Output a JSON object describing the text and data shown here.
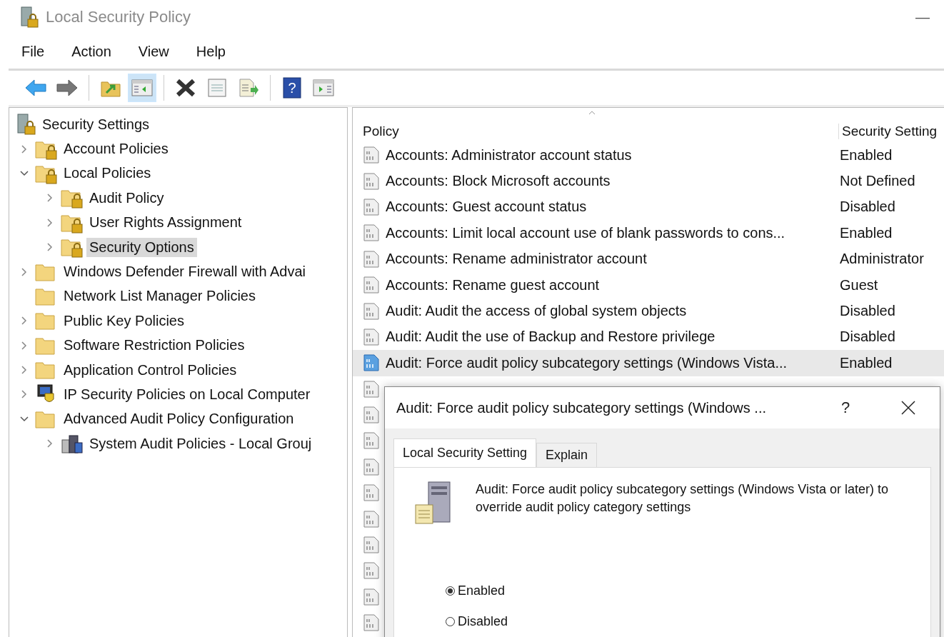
{
  "window": {
    "title": "Local Security Policy",
    "minimize": "—"
  },
  "menu": [
    "File",
    "Action",
    "View",
    "Help"
  ],
  "toolbar": [
    {
      "kind": "back",
      "selected": false
    },
    {
      "kind": "forward",
      "selected": false
    },
    {
      "kind": "sep"
    },
    {
      "kind": "up",
      "selected": false
    },
    {
      "kind": "tree",
      "selected": true
    },
    {
      "kind": "sep"
    },
    {
      "kind": "delete",
      "selected": false
    },
    {
      "kind": "properties",
      "selected": false
    },
    {
      "kind": "export",
      "selected": false
    },
    {
      "kind": "sep"
    },
    {
      "kind": "help",
      "label": "?",
      "selected": false
    },
    {
      "kind": "pane",
      "selected": false
    }
  ],
  "tree": {
    "label": "Security Settings",
    "children": [
      {
        "label": "Account Policies",
        "kind": "lockfolder",
        "expandable": true,
        "expanded": false,
        "selected": false
      },
      {
        "label": "Local Policies",
        "kind": "lockfolder",
        "expandable": true,
        "expanded": true,
        "selected": false,
        "children": [
          {
            "label": "Audit Policy",
            "kind": "lockfolder",
            "expandable": true,
            "expanded": false,
            "selected": false
          },
          {
            "label": "User Rights Assignment",
            "kind": "lockfolder",
            "expandable": true,
            "expanded": false,
            "selected": false
          },
          {
            "label": "Security Options",
            "kind": "lockfolder",
            "expandable": true,
            "expanded": false,
            "selected": true
          }
        ]
      },
      {
        "label": "Windows Defender Firewall with Advai",
        "kind": "folder",
        "expandable": true,
        "expanded": false,
        "selected": false
      },
      {
        "label": "Network List Manager Policies",
        "kind": "folder",
        "expandable": false,
        "selected": false
      },
      {
        "label": "Public Key Policies",
        "kind": "folder",
        "expandable": true,
        "expanded": false,
        "selected": false
      },
      {
        "label": "Software Restriction Policies",
        "kind": "folder",
        "expandable": true,
        "expanded": false,
        "selected": false
      },
      {
        "label": "Application Control Policies",
        "kind": "folder",
        "expandable": true,
        "expanded": false,
        "selected": false
      },
      {
        "label": "IP Security Policies on Local Computer",
        "kind": "ipsec",
        "expandable": true,
        "expanded": false,
        "selected": false
      },
      {
        "label": "Advanced Audit Policy Configuration",
        "kind": "folder",
        "expandable": true,
        "expanded": true,
        "selected": false,
        "children": [
          {
            "label": "System Audit Policies - Local Grouj",
            "kind": "audit",
            "expandable": true,
            "expanded": false,
            "selected": false
          }
        ]
      }
    ]
  },
  "table": {
    "columns": [
      "Policy",
      "Security Setting"
    ],
    "rows": [
      {
        "policy": "Accounts: Administrator account status",
        "setting": "Enabled",
        "selected": false
      },
      {
        "policy": "Accounts: Block Microsoft accounts",
        "setting": "Not Defined",
        "selected": false
      },
      {
        "policy": "Accounts: Guest account status",
        "setting": "Disabled",
        "selected": false
      },
      {
        "policy": "Accounts: Limit local account use of blank passwords to cons...",
        "setting": "Enabled",
        "selected": false
      },
      {
        "policy": "Accounts: Rename administrator account",
        "setting": "Administrator",
        "selected": false
      },
      {
        "policy": "Accounts: Rename guest account",
        "setting": "Guest",
        "selected": false
      },
      {
        "policy": "Audit: Audit the access of global system objects",
        "setting": "Disabled",
        "selected": false
      },
      {
        "policy": "Audit: Audit the use of Backup and Restore privilege",
        "setting": "Disabled",
        "selected": false
      },
      {
        "policy": "Audit: Force audit policy subcategory settings (Windows Vista...",
        "setting": "Enabled",
        "selected": true
      }
    ]
  },
  "dialog": {
    "title": "Audit: Force audit policy subcategory settings (Windows ...",
    "help": "?",
    "tabs": [
      {
        "label": "Local Security Setting",
        "selected": true
      },
      {
        "label": "Explain",
        "selected": false
      }
    ],
    "description": "Audit: Force audit policy subcategory settings (Windows Vista or later) to override audit policy category settings",
    "options": [
      {
        "label": "Enabled",
        "selected": true
      },
      {
        "label": "Disabled",
        "selected": false
      }
    ]
  }
}
